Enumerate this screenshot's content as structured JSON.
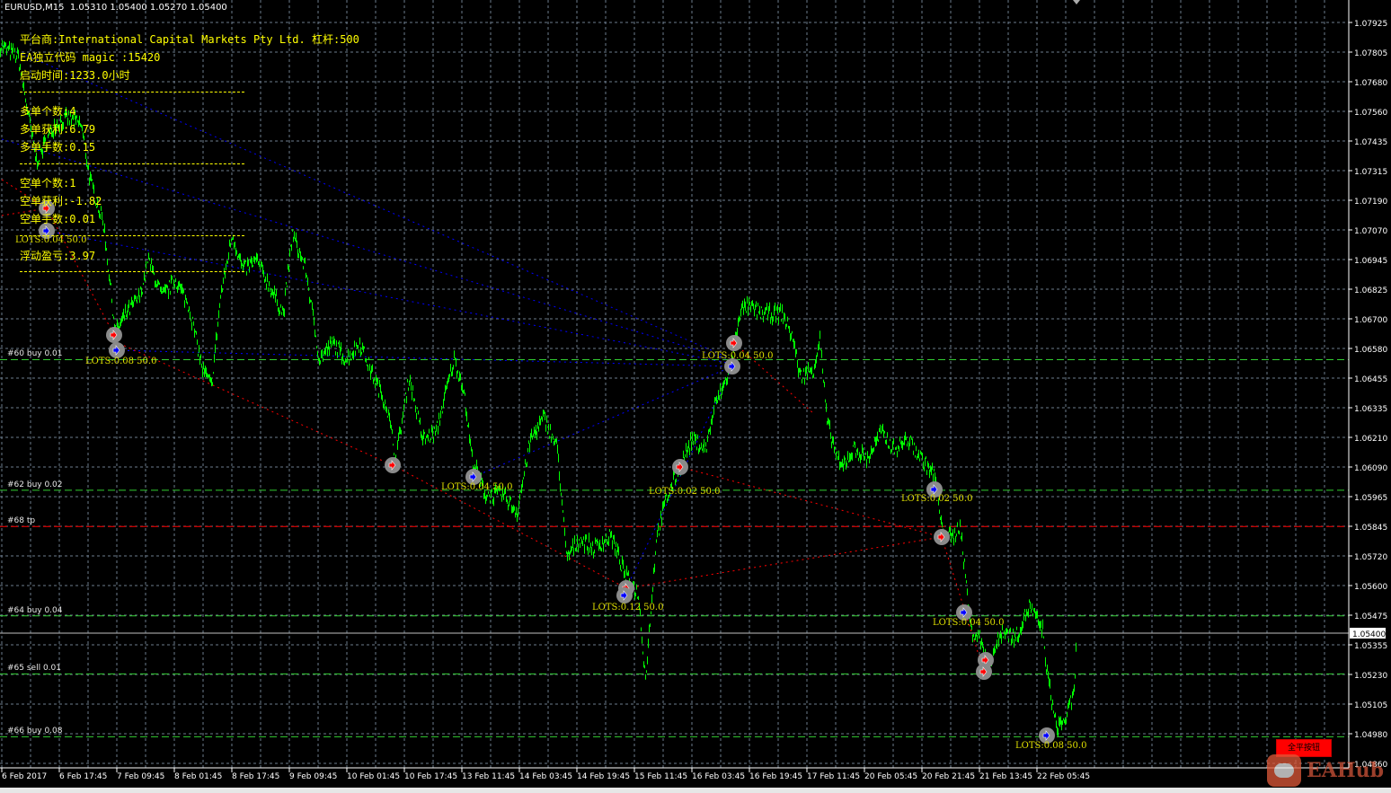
{
  "header": {
    "symbol": "EURUSD,M15",
    "ohlc": "1.05310 1.05400 1.05270 1.05400"
  },
  "info_panel": {
    "broker": "平台商:International Capital Markets Pty Ltd. 杠杆:500",
    "magic": "EA独立代码 magic :15420",
    "uptime": "启动时间:1233.0小时",
    "long_count": "多单个数:4",
    "long_profit": "多单获利:6.79",
    "long_lots": "多单手数:0.15",
    "short_count": "空单个数:1",
    "short_profit": "空单获利:-1.82",
    "short_lots": "空单手数:0.01",
    "floating_pl": "浮动盈亏:3.97"
  },
  "price_axis": [
    "1.07925",
    "1.07805",
    "1.07680",
    "1.07560",
    "1.07435",
    "1.07315",
    "1.07190",
    "1.07070",
    "1.06945",
    "1.06825",
    "1.06700",
    "1.06580",
    "1.06455",
    "1.06335",
    "1.06210",
    "1.06090",
    "1.05965",
    "1.05845",
    "1.05720",
    "1.05600",
    "1.05475",
    "1.05355",
    "1.05230",
    "1.05105",
    "1.04980",
    "1.04860"
  ],
  "bid_label": "1.05400",
  "time_axis": [
    "6 Feb 2017",
    "6 Feb 17:45",
    "7 Feb 09:45",
    "8 Feb 01:45",
    "8 Feb 17:45",
    "9 Feb 09:45",
    "10 Feb 01:45",
    "10 Feb 17:45",
    "13 Feb 11:45",
    "14 Feb 03:45",
    "14 Feb 19:45",
    "15 Feb 11:45",
    "16 Feb 03:45",
    "16 Feb 19:45",
    "17 Feb 11:45",
    "20 Feb 05:45",
    "20 Feb 21:45",
    "21 Feb 13:45",
    "22 Feb 05:45"
  ],
  "levels": [
    {
      "label": "#60 buy 0.01",
      "price": 1.0653,
      "color": "#32cd32"
    },
    {
      "label": "#62 buy 0.02",
      "price": 1.0599,
      "color": "#32cd32"
    },
    {
      "label": "#68 tp",
      "price": 1.0584,
      "color": "#ff0000"
    },
    {
      "label": "#64 buy 0.04",
      "price": 1.0547,
      "color": "#32cd32"
    },
    {
      "label": "#65 sell 0.01",
      "price": 1.0523,
      "color": "#32cd32"
    },
    {
      "label": "#66 buy 0.08",
      "price": 1.0497,
      "color": "#32cd32"
    }
  ],
  "lots_labels": [
    "LOTS:0.04 50.0",
    "LOTS:0.08 50.0",
    "LOTS:0.04 50.0",
    "LOTS:0.12 50.0",
    "LOTS:0.02 50.0",
    "LOTS:0.04 50.0",
    "LOTS:0.02 50.0",
    "LOTS:0.04 50.0",
    "LOTS:0.08 50.0"
  ],
  "close_all_button": "全平按钮",
  "watermark": "EAHub",
  "colors": {
    "price": "#00ff00",
    "grid": "#6b7b8c",
    "info": "#ffff00",
    "bid": "#c0c0c0"
  },
  "chart_data": {
    "type": "line",
    "symbol": "EURUSD",
    "timeframe": "M15",
    "ylim": [
      1.0486,
      1.07925
    ],
    "price_keypoints_bar_price": [
      [
        0,
        1.0783
      ],
      [
        20,
        1.0778
      ],
      [
        40,
        1.0735
      ],
      [
        60,
        1.075
      ],
      [
        75,
        1.0753
      ],
      [
        90,
        1.075
      ],
      [
        100,
        1.0727
      ],
      [
        115,
        1.0709
      ],
      [
        128,
        1.0664
      ],
      [
        140,
        1.0672
      ],
      [
        155,
        1.0679
      ],
      [
        165,
        1.0694
      ],
      [
        180,
        1.0679
      ],
      [
        195,
        1.0686
      ],
      [
        210,
        1.0675
      ],
      [
        225,
        1.0649
      ],
      [
        235,
        1.0642
      ],
      [
        245,
        1.0679
      ],
      [
        258,
        1.0705
      ],
      [
        270,
        1.069
      ],
      [
        285,
        1.0694
      ],
      [
        300,
        1.0683
      ],
      [
        315,
        1.0672
      ],
      [
        325,
        1.0705
      ],
      [
        340,
        1.069
      ],
      [
        355,
        1.0653
      ],
      [
        370,
        1.066
      ],
      [
        385,
        1.0653
      ],
      [
        400,
        1.066
      ],
      [
        415,
        1.0646
      ],
      [
        430,
        1.0634
      ],
      [
        440,
        1.0612
      ],
      [
        455,
        1.0646
      ],
      [
        470,
        1.062
      ],
      [
        485,
        1.0623
      ],
      [
        500,
        1.0646
      ],
      [
        505,
        1.0653
      ],
      [
        515,
        1.0642
      ],
      [
        525,
        1.0612
      ],
      [
        540,
        1.0597
      ],
      [
        560,
        1.0597
      ],
      [
        575,
        1.059
      ],
      [
        590,
        1.062
      ],
      [
        605,
        1.0629
      ],
      [
        620,
        1.0616
      ],
      [
        630,
        1.0571
      ],
      [
        645,
        1.0579
      ],
      [
        660,
        1.0575
      ],
      [
        680,
        1.058
      ],
      [
        695,
        1.0564
      ],
      [
        710,
        1.0556
      ],
      [
        718,
        1.0521
      ],
      [
        730,
        1.0579
      ],
      [
        740,
        1.0594
      ],
      [
        755,
        1.0608
      ],
      [
        770,
        1.062
      ],
      [
        785,
        1.0616
      ],
      [
        795,
        1.0634
      ],
      [
        805,
        1.0642
      ],
      [
        815,
        1.0653
      ],
      [
        822,
        1.0672
      ],
      [
        830,
        1.0675
      ],
      [
        850,
        1.0672
      ],
      [
        870,
        1.0672
      ],
      [
        882,
        1.0662
      ],
      [
        890,
        1.0646
      ],
      [
        905,
        1.0649
      ],
      [
        912,
        1.0662
      ],
      [
        920,
        1.0627
      ],
      [
        935,
        1.0608
      ],
      [
        950,
        1.0616
      ],
      [
        965,
        1.0612
      ],
      [
        980,
        1.0623
      ],
      [
        995,
        1.0616
      ],
      [
        1010,
        1.062
      ],
      [
        1025,
        1.0612
      ],
      [
        1040,
        1.0605
      ],
      [
        1048,
        1.0582
      ],
      [
        1060,
        1.0579
      ],
      [
        1068,
        1.0585
      ],
      [
        1075,
        1.056
      ],
      [
        1080,
        1.0541
      ],
      [
        1090,
        1.0538
      ],
      [
        1100,
        1.0527
      ],
      [
        1115,
        1.0541
      ],
      [
        1130,
        1.0538
      ],
      [
        1145,
        1.0551
      ],
      [
        1160,
        1.0541
      ],
      [
        1165,
        1.0523
      ],
      [
        1175,
        1.0501
      ],
      [
        1185,
        1.0504
      ],
      [
        1195,
        1.0515
      ],
      [
        1198,
        1.054
      ]
    ]
  }
}
